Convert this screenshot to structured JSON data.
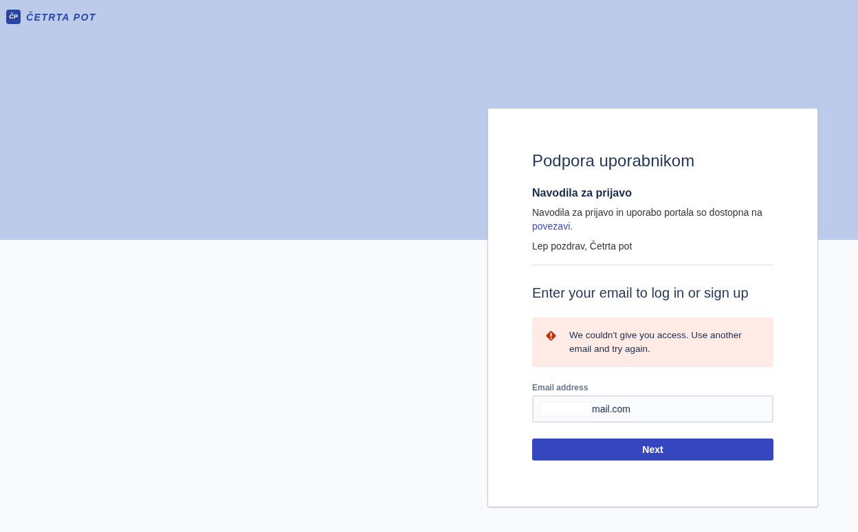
{
  "logo": {
    "mark": "ČP",
    "name": "ČETRTA POT"
  },
  "card": {
    "title": "Podpora uporabnikom",
    "notice": {
      "heading": "Navodila za prijavo",
      "text": "Navodila za prijavo in uporabo portala so dostopna na",
      "link": "povezavi",
      "after_link": ".",
      "signature": "Lep pozdrav, Četrta pot"
    }
  },
  "login": {
    "heading": "Enter your email to log in or sign up",
    "error": {
      "text": "We couldn't give you access. Use another email and try again."
    },
    "email": {
      "label": "Email address",
      "value": "mail.com"
    },
    "button": "Next"
  }
}
